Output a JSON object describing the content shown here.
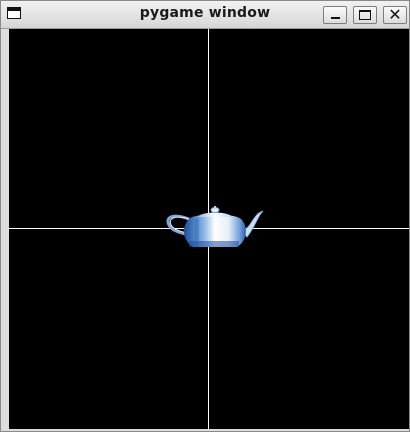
{
  "window": {
    "title": "pygame window",
    "icons": {
      "menu": "window-menu-icon",
      "minimize": "minimize-icon",
      "maximize": "maximize-icon",
      "close": "close-icon"
    },
    "close_glyph": "✕"
  },
  "scene": {
    "background_color": "#000000",
    "axis_color": "#ffffff",
    "object": "teapot",
    "object_colors": [
      "#ffffff",
      "#cfe0f4",
      "#8fb6e2",
      "#4f86c6",
      "#1d4f9c"
    ]
  }
}
